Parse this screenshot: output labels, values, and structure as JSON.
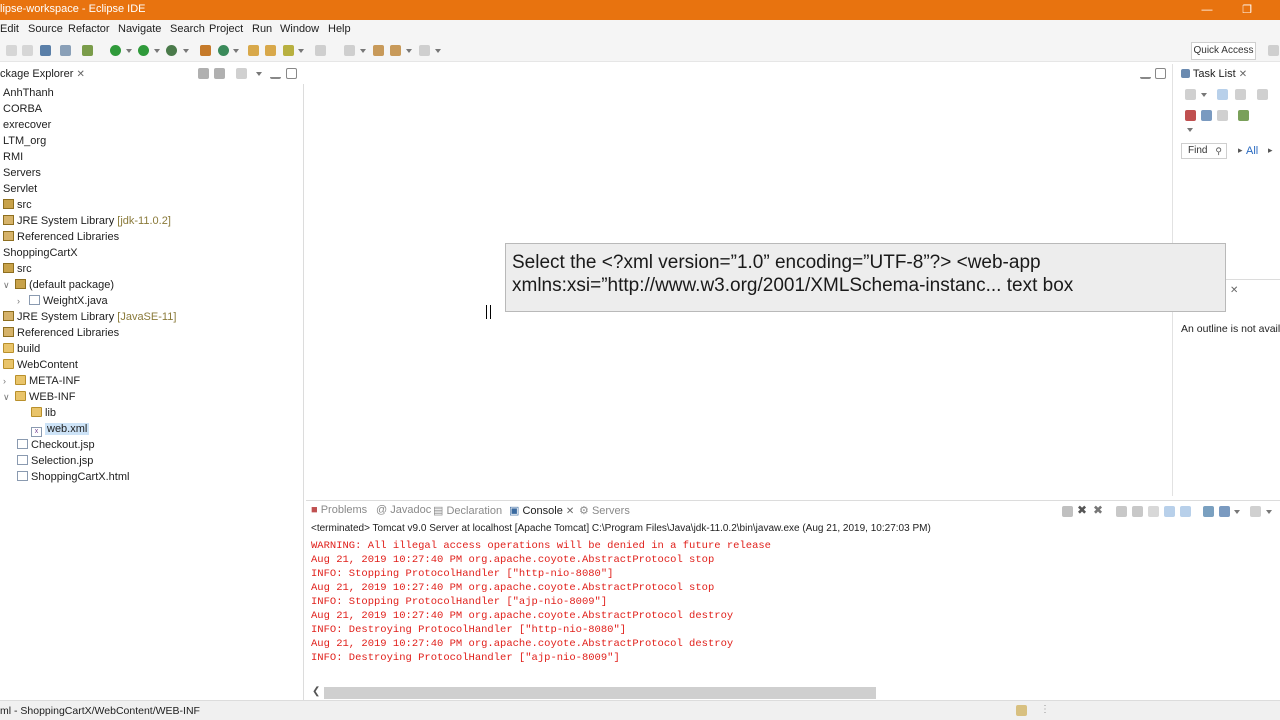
{
  "window": {
    "title": "lipse-workspace - Eclipse IDE"
  },
  "menu": [
    "Edit",
    "Source",
    "Refactor",
    "Navigate",
    "Search",
    "Project",
    "Run",
    "Window",
    "Help"
  ],
  "toolbar": {
    "quick_access": "Quick Access"
  },
  "package_explorer": {
    "title": "ckage Explorer",
    "items": [
      {
        "label": "AnhThanh",
        "deco": ""
      },
      {
        "label": "CORBA",
        "deco": ""
      },
      {
        "label": "exrecover",
        "deco": ""
      },
      {
        "label": "LTM_org",
        "deco": ""
      },
      {
        "label": "RMI",
        "deco": ""
      },
      {
        "label": "Servers",
        "deco": ""
      },
      {
        "label": "Servlet",
        "deco": ""
      },
      {
        "label": "src",
        "deco": ""
      },
      {
        "label": "JRE System Library",
        "deco": "[jdk-11.0.2]"
      },
      {
        "label": "Referenced Libraries",
        "deco": ""
      },
      {
        "label": "ShoppingCartX",
        "deco": ""
      },
      {
        "label": "src",
        "deco": ""
      },
      {
        "label": "(default package)",
        "deco": ""
      },
      {
        "label": "WeightX.java",
        "deco": ""
      },
      {
        "label": "JRE System Library",
        "deco": "[JavaSE-11]"
      },
      {
        "label": "Referenced Libraries",
        "deco": ""
      },
      {
        "label": "build",
        "deco": ""
      },
      {
        "label": "WebContent",
        "deco": ""
      },
      {
        "label": "META-INF",
        "deco": ""
      },
      {
        "label": "WEB-INF",
        "deco": ""
      },
      {
        "label": "lib",
        "deco": ""
      },
      {
        "label": "web.xml",
        "deco": ""
      },
      {
        "label": "Checkout.jsp",
        "deco": ""
      },
      {
        "label": "Selection.jsp",
        "deco": ""
      },
      {
        "label": "ShoppingCartX.html",
        "deco": ""
      }
    ]
  },
  "tooltip": {
    "line1": "Select the <?xml version=”1.0” encoding=”UTF-8”?>  <web-app",
    "line2": "xmlns:xsi=”http://www.w3.org/2001/XMLSchema-instanc... text box"
  },
  "task_list": {
    "title": "Task List",
    "find_placeholder": "Find",
    "all_label": "All"
  },
  "outline": {
    "message": "An outline is not avail"
  },
  "bottom_tabs": {
    "problems": "Problems",
    "javadoc": "Javadoc",
    "declaration": "Declaration",
    "console": "Console",
    "servers": "Servers"
  },
  "console": {
    "header": "<terminated> Tomcat v9.0 Server at localhost [Apache Tomcat] C:\\Program Files\\Java\\jdk-11.0.2\\bin\\javaw.exe (Aug 21, 2019, 10:27:03 PM)",
    "lines": [
      "WARNING: All illegal access operations will be denied in a future release",
      "Aug 21, 2019 10:27:40 PM org.apache.coyote.AbstractProtocol stop",
      "INFO: Stopping ProtocolHandler [\"http-nio-8080\"]",
      "Aug 21, 2019 10:27:40 PM org.apache.coyote.AbstractProtocol stop",
      "INFO: Stopping ProtocolHandler [\"ajp-nio-8009\"]",
      "Aug 21, 2019 10:27:40 PM org.apache.coyote.AbstractProtocol destroy",
      "INFO: Destroying ProtocolHandler [\"http-nio-8080\"]",
      "Aug 21, 2019 10:27:40 PM org.apache.coyote.AbstractProtocol destroy",
      "INFO: Destroying ProtocolHandler [\"ajp-nio-8009\"]"
    ]
  },
  "status": {
    "path": "ml - ShoppingCartX/WebContent/WEB-INF"
  },
  "colors": {
    "title_bar": "#e8730f",
    "console_text": "#e0201b",
    "selection": "#cde3f7"
  }
}
